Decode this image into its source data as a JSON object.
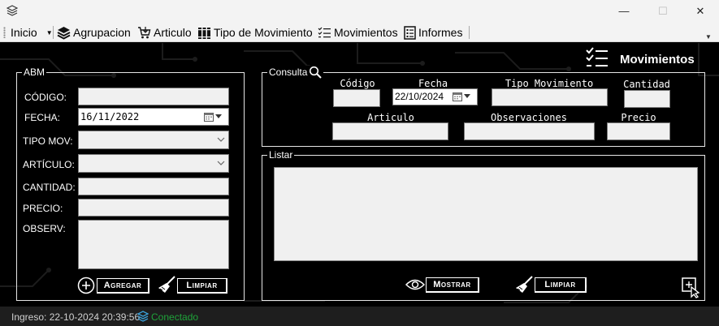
{
  "window": {
    "minimize_glyph": "—",
    "maximize_glyph": "☐",
    "close_glyph": "✕"
  },
  "menu": {
    "inicio": "Inicio",
    "agrupacion": "Agrupacion",
    "articulo": "Articulo",
    "tipo_movimiento": "Tipo de Movimiento",
    "movimientos": "Movimientos",
    "informes": "Informes"
  },
  "header": {
    "title": "Movimientos",
    "icon": "checklist-icon"
  },
  "abm": {
    "legend": "ABM",
    "labels": {
      "codigo": "CÓDIGO:",
      "fecha": "FECHA:",
      "tipo_mov": "TIPO MOV:",
      "articulo": "ARTÍCULO:",
      "cantidad": "CANTIDAD:",
      "precio": "PRECIO:",
      "observ": "OBSERV:"
    },
    "values": {
      "codigo": "",
      "fecha": "16/11/2022",
      "tipo_mov": "",
      "articulo": "",
      "cantidad": "",
      "precio": "",
      "observ": ""
    },
    "buttons": {
      "agregar": "Agregar",
      "limpiar": "Limpiar"
    }
  },
  "consulta": {
    "legend": "Consulta",
    "labels": {
      "codigo": "Código",
      "fecha": "Fecha",
      "tipo_movimiento": "Tipo Movimiento",
      "cantidad": "Cantidad",
      "articulo": "Articulo",
      "observaciones": "Observaciones",
      "precio": "Precio"
    },
    "values": {
      "codigo": "",
      "fecha": "22/10/2024",
      "tipo_movimiento": "",
      "cantidad": "",
      "articulo": "",
      "observaciones": "",
      "precio": ""
    }
  },
  "listar": {
    "legend": "Listar",
    "buttons": {
      "mostrar": "Mostrar",
      "limpiar": "Limpiar"
    }
  },
  "status": {
    "ingreso": "Ingreso: 22-10-2024 20:39:56",
    "conectado": "Conectado",
    "conectado_color": "#1fa33a",
    "ingreso_color": "#d0d0d0"
  }
}
